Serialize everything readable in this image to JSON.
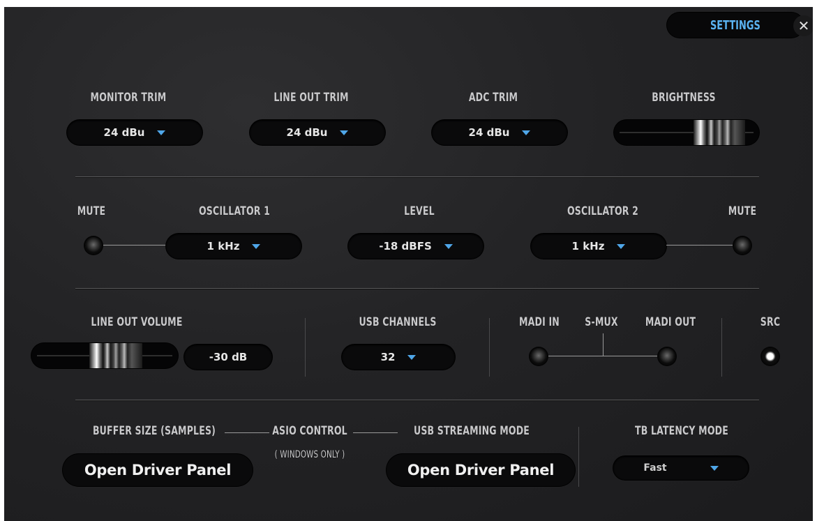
{
  "header": {
    "settings_label": "SETTINGS",
    "close_glyph": "✕"
  },
  "row1": {
    "monitor_trim": {
      "label": "MONITOR TRIM",
      "value": "24 dBu"
    },
    "line_out_trim": {
      "label": "LINE OUT TRIM",
      "value": "24 dBu"
    },
    "adc_trim": {
      "label": "ADC TRIM",
      "value": "24 dBu"
    },
    "brightness": {
      "label": "BRIGHTNESS",
      "level": 0.85
    }
  },
  "row2": {
    "mute_left_label": "MUTE",
    "oscillator1": {
      "label": "OSCILLATOR 1",
      "value": "1 kHz"
    },
    "level": {
      "label": "LEVEL",
      "value": "-18 dBFS"
    },
    "oscillator2": {
      "label": "OSCILLATOR 2",
      "value": "1 kHz"
    },
    "mute_right_label": "MUTE"
  },
  "row3": {
    "line_out_volume": {
      "label": "LINE OUT VOLUME",
      "value": "-30 dB",
      "level": 0.62
    },
    "usb_channels": {
      "label": "USB CHANNELS",
      "value": "32"
    },
    "madi_in_label": "MADI IN",
    "smux_label": "S-MUX",
    "madi_out_label": "MADI OUT",
    "src_label": "SRC"
  },
  "row4": {
    "buffer_size_label": "BUFFER SIZE (SAMPLES)",
    "asio_control_label": "ASIO CONTROL",
    "windows_only_label": "( WINDOWS ONLY )",
    "usb_streaming_label": "USB STREAMING MODE",
    "open_driver_panel_1": "Open Driver Panel",
    "open_driver_panel_2": "Open Driver Panel",
    "tb_latency": {
      "label": "TB LATENCY MODE",
      "value": "Fast"
    }
  },
  "colors": {
    "accent": "#4fa6e8",
    "settings_text": "#5ab2f0",
    "background": "#232325"
  }
}
